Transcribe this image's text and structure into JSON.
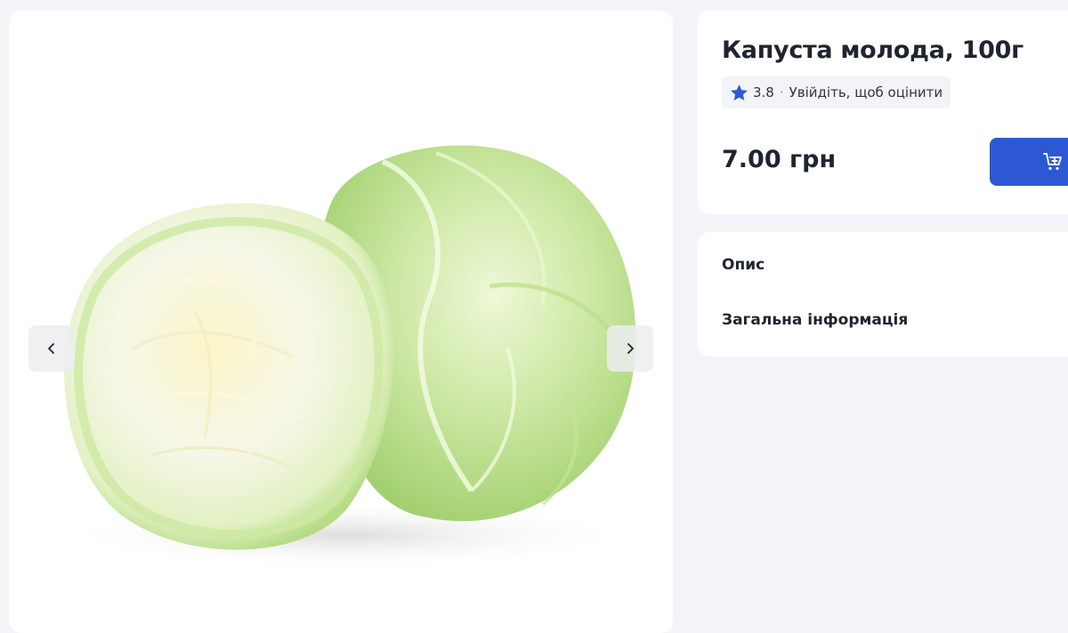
{
  "product": {
    "title": "Капуста молода, 100г",
    "rating_value": "3.8",
    "rating_separator": "·",
    "rate_prompt": "Увійдіть, щоб оцінити",
    "price": "7.00 грн"
  },
  "info_sections": {
    "description": "Опис",
    "general": "Загальна інформація"
  },
  "icons": {
    "prev": "chevron-left-icon",
    "next": "chevron-right-icon",
    "rating": "star-icon",
    "cart": "add-to-cart-icon"
  },
  "colors": {
    "accent": "#2c59d3",
    "star": "#2c59d3",
    "page_bg": "#f4f5f9"
  }
}
